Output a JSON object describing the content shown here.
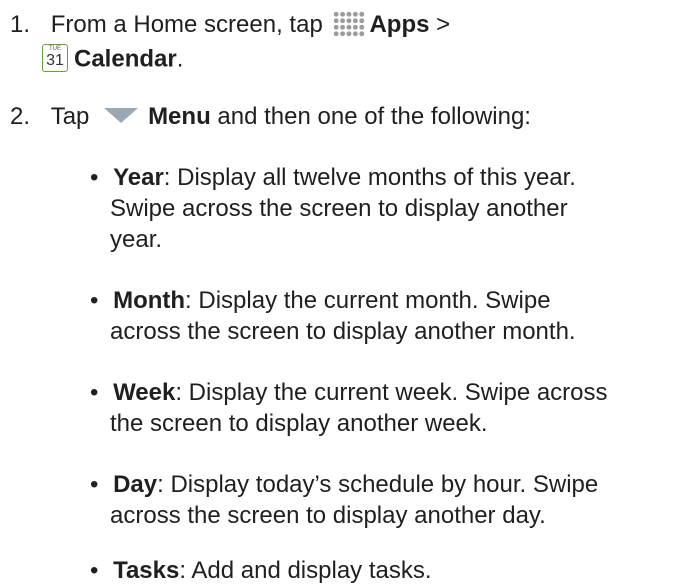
{
  "step1": {
    "number": "1.",
    "text_a": "From a Home screen, tap",
    "apps_label": "Apps",
    "arrow": ">",
    "calendar_icon_top": "TUE",
    "calendar_icon_day": "31",
    "calendar_label": "Calendar",
    "end": "."
  },
  "step2": {
    "number": "2.",
    "text_a": "Tap",
    "menu_label": "Menu",
    "text_b": "and then one of the following:"
  },
  "bullets": {
    "year": {
      "term": "Year",
      "line1": ": Display all twelve months of this year.",
      "line2": "Swipe across the screen to display another",
      "line3": "year."
    },
    "month": {
      "term": "Month",
      "line1": ": Display the current month. Swipe",
      "line2": "across the screen to display another month."
    },
    "week": {
      "term": "Week",
      "line1": ": Display the current week. Swipe across",
      "line2": "the screen to display another week."
    },
    "day": {
      "term": "Day",
      "line1": ": Display today’s schedule by hour. Swipe",
      "line2": "across the screen to display another day."
    },
    "tasks": {
      "term": "Tasks",
      "line1": ": Add and display tasks."
    }
  },
  "bullet_glyph": "•"
}
